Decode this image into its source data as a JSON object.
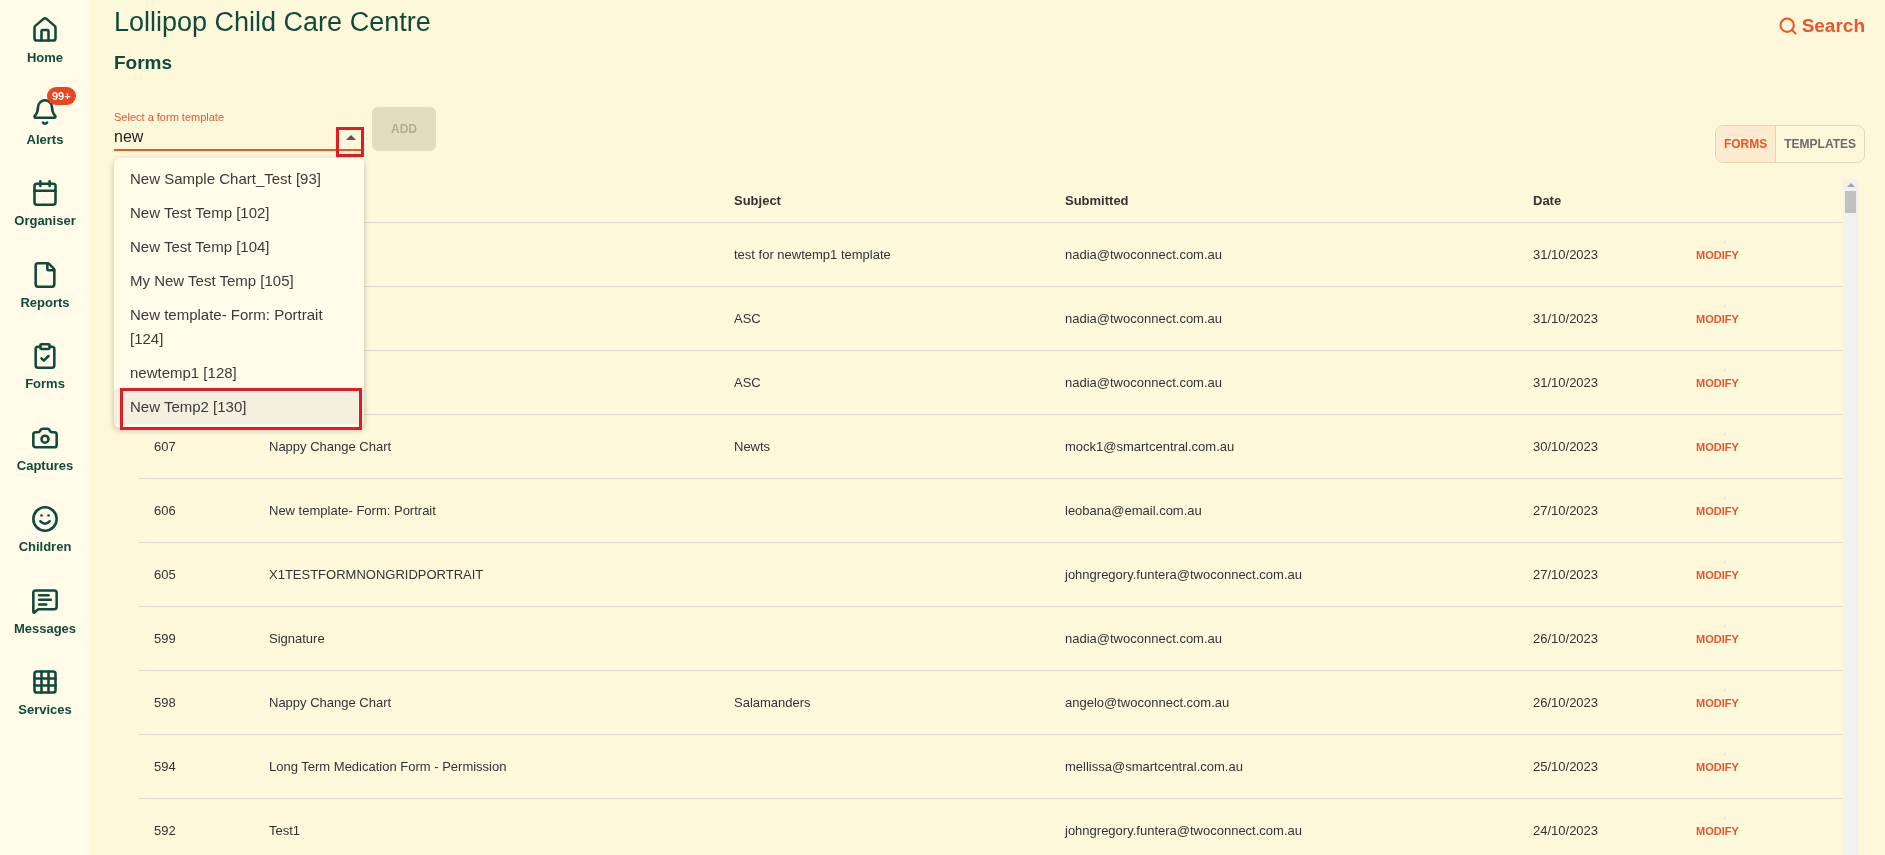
{
  "sidebar": {
    "items": [
      {
        "label": "Home"
      },
      {
        "label": "Alerts",
        "badge": "99+"
      },
      {
        "label": "Organiser"
      },
      {
        "label": "Reports"
      },
      {
        "label": "Forms"
      },
      {
        "label": "Captures"
      },
      {
        "label": "Children"
      },
      {
        "label": "Messages"
      },
      {
        "label": "Services"
      }
    ]
  },
  "header": {
    "title": "Lollipop Child Care Centre",
    "search": "Search"
  },
  "page_title": "Forms",
  "template_select": {
    "label": "Select a form template",
    "value": "new",
    "add_button": "ADD",
    "options": [
      {
        "label": "New Sample Chart_Test [93]",
        "selected": false
      },
      {
        "label": "New Test Temp [102]",
        "selected": false
      },
      {
        "label": "New Test Temp [104]",
        "selected": false
      },
      {
        "label": "My New Test Temp [105]",
        "selected": false
      },
      {
        "label": "New template- Form: Portrait [124]",
        "selected": false
      },
      {
        "label": "newtemp1 [128]",
        "selected": false
      },
      {
        "label": "New Temp2 [130]",
        "selected": true
      }
    ]
  },
  "view_tabs": [
    {
      "label": "FORMS",
      "selected": true
    },
    {
      "label": "TEMPLATES",
      "selected": false
    }
  ],
  "table": {
    "columns": [
      "Subject",
      "Submitted",
      "Date"
    ],
    "rows": [
      {
        "subject": "test for newtemp1 template",
        "submitted": "nadia@twoconnect.com.au",
        "date": "31/10/2023",
        "action": "MODIFY"
      },
      {
        "subject": "ASC",
        "submitted": "nadia@twoconnect.com.au",
        "date": "31/10/2023",
        "action": "MODIFY"
      },
      {
        "subject": "ASC",
        "submitted": "nadia@twoconnect.com.au",
        "date": "31/10/2023",
        "action": "MODIFY"
      },
      {
        "id": "607",
        "name": "Nappy Change Chart",
        "subject": "Newts",
        "submitted": "mock1@smartcentral.com.au",
        "date": "30/10/2023",
        "action": "MODIFY"
      },
      {
        "id": "606",
        "name": "New template- Form: Portrait",
        "submitted": "leobana@email.com.au",
        "date": "27/10/2023",
        "action": "MODIFY"
      },
      {
        "id": "605",
        "name": "X1TESTFORMNONGRIDPORTRAIT",
        "submitted": "johngregory.funtera@twoconnect.com.au",
        "date": "27/10/2023",
        "action": "MODIFY"
      },
      {
        "id": "599",
        "name": "Signature",
        "submitted": "nadia@twoconnect.com.au",
        "date": "26/10/2023",
        "action": "MODIFY"
      },
      {
        "id": "598",
        "name": "Nappy Change Chart",
        "subject": "Salamanders",
        "submitted": "angelo@twoconnect.com.au",
        "date": "26/10/2023",
        "action": "MODIFY"
      },
      {
        "id": "594",
        "name": "Long Term Medication Form - Permission",
        "submitted": "mellissa@smartcentral.com.au",
        "date": "25/10/2023",
        "action": "MODIFY"
      },
      {
        "id": "592",
        "name": "Test1",
        "submitted": "johngregory.funtera@twoconnect.com.au",
        "date": "24/10/2023",
        "action": "MODIFY"
      }
    ]
  }
}
